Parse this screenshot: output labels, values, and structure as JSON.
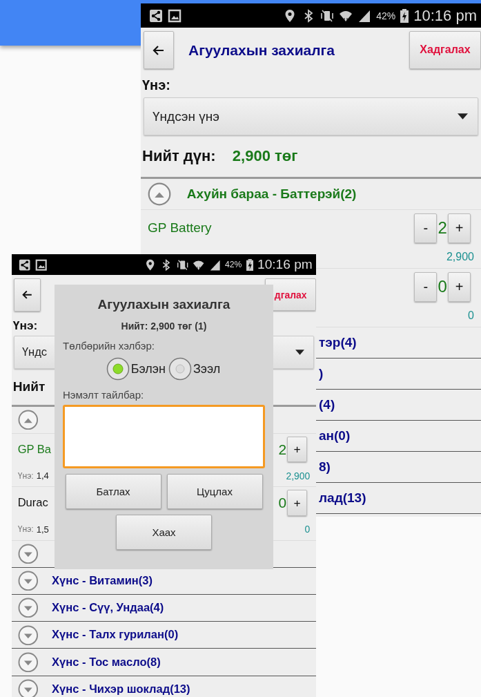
{
  "back_screen": {
    "status_bar": {
      "battery": "42%",
      "time": "10:16 pm"
    },
    "app_bar": {
      "title": "Агуулахын захиалга",
      "save_button": "Хадгалах"
    },
    "price_label": "Үнэ:",
    "price_dropdown": {
      "value": "Үндсэн үнэ"
    },
    "total_label": "Нийт дүн:",
    "total_value": "2,900 төг",
    "groups": [
      {
        "label": "Ахуйн бараа - Баттерэй(2)",
        "expanded": true,
        "items": [
          {
            "name": "GP Battery",
            "ordered": true,
            "decrement": "-",
            "quantity": "2",
            "increment": "+",
            "amount": "2,900"
          },
          {
            "decrement": "-",
            "quantity": "0",
            "increment": "+",
            "amount": "0"
          }
        ]
      }
    ],
    "group_fragments": [
      "тэр(4)",
      ")",
      "(4)",
      "ан(0)",
      "8)",
      "лад(13)"
    ]
  },
  "front_screen": {
    "status_bar": {
      "battery": "42%",
      "time": "10:16 pm"
    },
    "app_bar": {
      "save_button": "дгалах"
    },
    "price_label": "Үнэ:",
    "price_dropdown": {
      "value": "Үндс"
    },
    "total_label": "Нийт",
    "groups": [
      {
        "expanded": true,
        "items": [
          {
            "name": "GP Ba",
            "ordered": true,
            "price_label": "Үнэ:",
            "price": "1,4",
            "quantity": "2",
            "increment": "+",
            "amount": "2,900"
          },
          {
            "name": "Durac",
            "ordered": false,
            "price_label": "Үнэ:",
            "price": "1,5",
            "quantity": "0",
            "increment": "+",
            "amount": "0"
          }
        ]
      },
      {
        "expanded": false
      },
      {
        "label": "Хүнс - Витамин(3)",
        "expanded": false
      },
      {
        "label": "Хүнс - Сүү, Ундаа(4)",
        "expanded": false
      },
      {
        "label": "Хүнс - Талх гурилан(0)",
        "expanded": false
      },
      {
        "label": "Хүнс - Тос масло(8)",
        "expanded": false
      },
      {
        "label": "Хүнс - Чихэр шоклад(13)",
        "expanded": false
      }
    ]
  },
  "dialog": {
    "title": "Агуулахын захиалга",
    "total": "Нийт: 2,900 төг (1)",
    "payment_label": "Төлбөрийн хэлбэр:",
    "payment_options": [
      {
        "label": "Бэлэн",
        "selected": true
      },
      {
        "label": "Зээл",
        "selected": false
      }
    ],
    "note_label": "Нэмэлт тайлбар:",
    "note_field": {
      "focused": true
    },
    "buttons": [
      "Батлах",
      "Цуцлах"
    ],
    "close_button": "Хаах"
  }
}
